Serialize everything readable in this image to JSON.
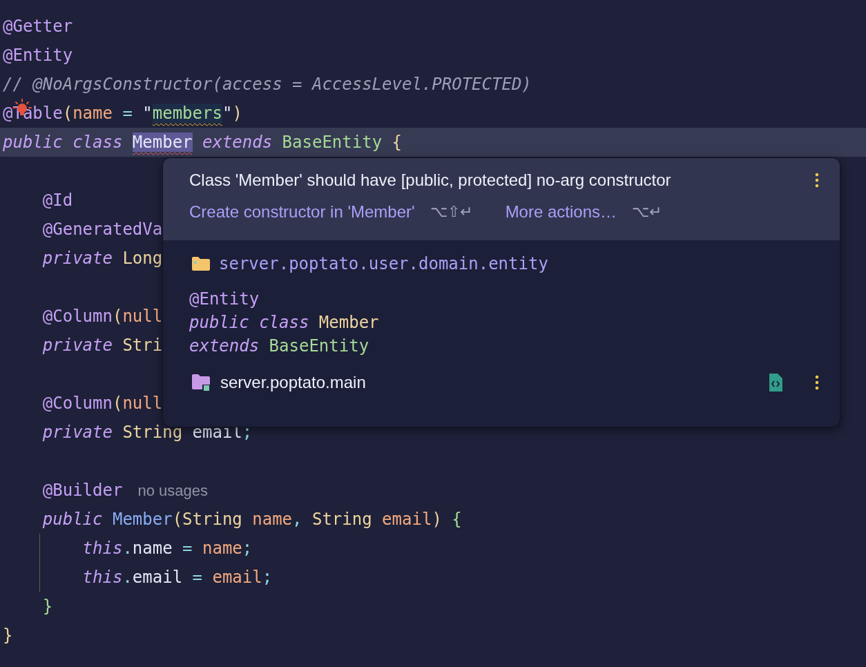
{
  "editor": {
    "blocks": [
      {
        "lines": [
          {
            "tokens": [
              {
                "text": "@Getter",
                "kind": "annotation"
              }
            ]
          },
          {
            "tokens": [
              {
                "text": "@Entity",
                "kind": "annotation"
              }
            ]
          },
          {
            "tokens": [
              {
                "text": "// @NoArgsConstructor(access = AccessLevel.PROTECTED)",
                "kind": "comment"
              }
            ]
          },
          {
            "bulb": true,
            "tokens": [
              {
                "text": "@Table",
                "kind": "annotation"
              },
              {
                "text": "(",
                "kind": "bracket"
              },
              {
                "text": "name",
                "kind": "param"
              },
              {
                "text": " = ",
                "kind": "operator"
              },
              {
                "text": "\"",
                "kind": "plain"
              },
              {
                "text": "members",
                "kind": "string",
                "occurrence": true,
                "warning": true
              },
              {
                "text": "\"",
                "kind": "plain"
              },
              {
                "text": ")",
                "kind": "bracket"
              }
            ]
          },
          {
            "current": true,
            "tokens": [
              {
                "text": "public class ",
                "kind": "keyword"
              },
              {
                "text": "Member",
                "kind": "plain",
                "selected": true,
                "error": true
              },
              {
                "text": " extends ",
                "kind": "keyword"
              },
              {
                "text": "BaseEntity",
                "kind": "string"
              },
              {
                "text": " {",
                "kind": "bracket"
              }
            ]
          }
        ]
      },
      {
        "lines": [
          {
            "tokens": [
              {
                "text": "    @Id",
                "kind": "annotation"
              }
            ]
          },
          {
            "tokens": [
              {
                "text": "    @GeneratedVa",
                "kind": "annotation"
              }
            ]
          },
          {
            "tokens": [
              {
                "text": "    private ",
                "kind": "keyword"
              },
              {
                "text": "Long",
                "kind": "type"
              }
            ]
          }
        ]
      },
      {
        "lines": [
          {
            "tokens": [
              {
                "text": "    @Column",
                "kind": "annotation"
              },
              {
                "text": "(",
                "kind": "bracket"
              },
              {
                "text": "null",
                "kind": "param"
              }
            ]
          },
          {
            "tokens": [
              {
                "text": "    private ",
                "kind": "keyword"
              },
              {
                "text": "Stri",
                "kind": "type"
              }
            ]
          }
        ]
      },
      {
        "lines": [
          {
            "tokens": [
              {
                "text": "    @Column",
                "kind": "annotation"
              },
              {
                "text": "(",
                "kind": "bracket"
              },
              {
                "text": "null",
                "kind": "param"
              }
            ]
          },
          {
            "tokens": [
              {
                "text": "    private ",
                "kind": "keyword"
              },
              {
                "text": "String",
                "kind": "type"
              },
              {
                "text": " email",
                "kind": "plain"
              },
              {
                "text": ";",
                "kind": "operator"
              }
            ]
          }
        ]
      },
      {
        "lines": [
          {
            "tokens": [
              {
                "text": "    @Builder",
                "kind": "annotation"
              },
              {
                "text": "no usages",
                "kind": "hint"
              }
            ]
          },
          {
            "tokens": [
              {
                "text": "    public ",
                "kind": "keyword"
              },
              {
                "text": "Member",
                "kind": "method"
              },
              {
                "text": "(",
                "kind": "bracket"
              },
              {
                "text": "String",
                "kind": "type"
              },
              {
                "text": " name",
                "kind": "param"
              },
              {
                "text": ", ",
                "kind": "operator"
              },
              {
                "text": "String",
                "kind": "type"
              },
              {
                "text": " email",
                "kind": "param"
              },
              {
                "text": ")",
                "kind": "bracket"
              },
              {
                "text": " {",
                "kind": "string"
              }
            ]
          },
          {
            "guide": true,
            "tokens": [
              {
                "text": "        this",
                "kind": "keyword"
              },
              {
                "text": ".",
                "kind": "operator"
              },
              {
                "text": "name",
                "kind": "plain"
              },
              {
                "text": " = ",
                "kind": "operator"
              },
              {
                "text": "name",
                "kind": "param"
              },
              {
                "text": ";",
                "kind": "operator"
              }
            ]
          },
          {
            "guide": true,
            "tokens": [
              {
                "text": "        this",
                "kind": "keyword"
              },
              {
                "text": ".",
                "kind": "operator"
              },
              {
                "text": "email",
                "kind": "plain"
              },
              {
                "text": " = ",
                "kind": "operator"
              },
              {
                "text": "email",
                "kind": "param"
              },
              {
                "text": ";",
                "kind": "operator"
              }
            ]
          },
          {
            "tokens": [
              {
                "text": "    }",
                "kind": "string"
              }
            ]
          },
          {
            "tokens": [
              {
                "text": "}",
                "kind": "bracket"
              }
            ]
          }
        ]
      }
    ]
  },
  "popup": {
    "message": "Class 'Member' should have [public, protected] no-arg constructor",
    "actions": [
      {
        "label": "Create constructor in 'Member'",
        "shortcut": "⌥⇧↵"
      },
      {
        "label": "More actions…",
        "shortcut": "⌥↵"
      }
    ],
    "package": "server.poptato.user.domain.entity",
    "declaration": [
      [
        {
          "text": "@Entity",
          "kind": "annotation"
        }
      ],
      [
        {
          "text": "public class ",
          "kind": "keyword"
        },
        {
          "text": "Member",
          "kind": "type"
        }
      ],
      [
        {
          "text": "extends ",
          "kind": "keyword"
        },
        {
          "text": "BaseEntity",
          "kind": "string"
        }
      ]
    ],
    "module": "server.poptato.main"
  }
}
